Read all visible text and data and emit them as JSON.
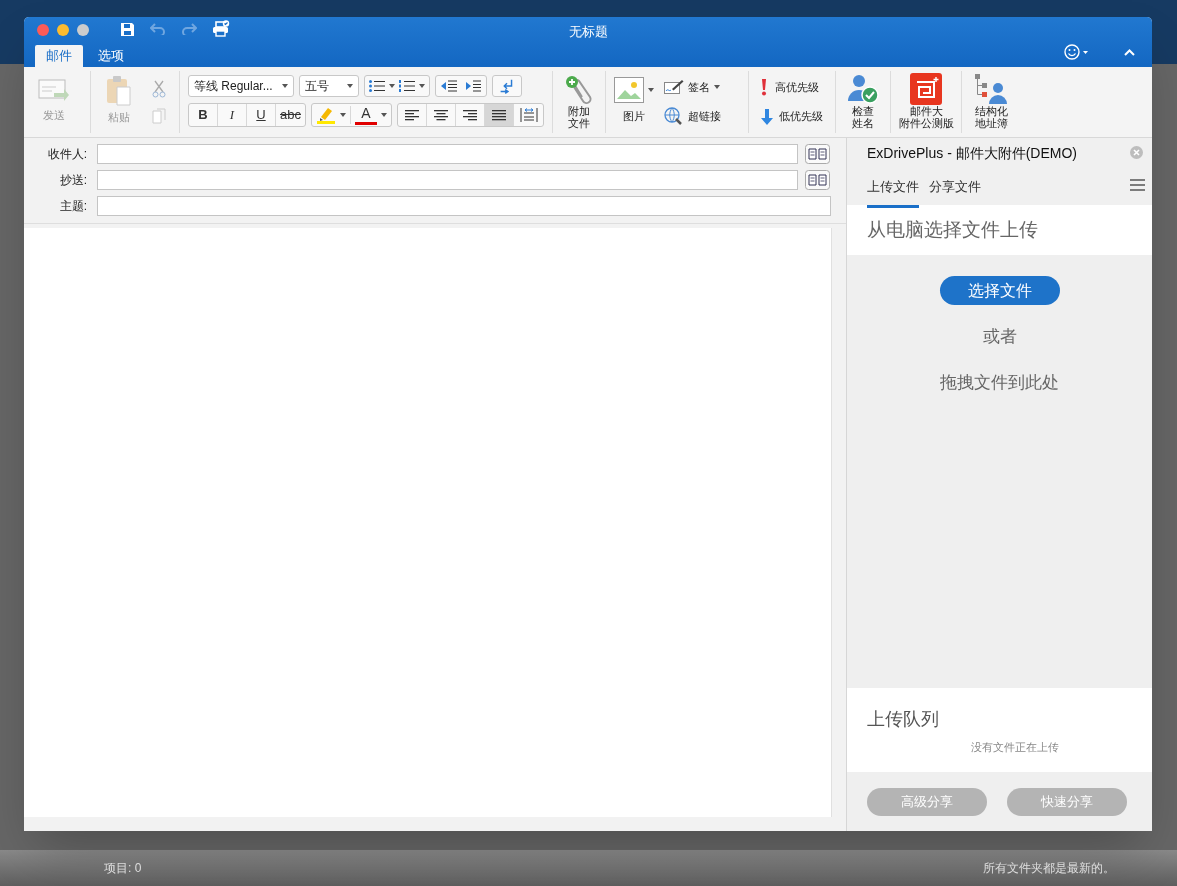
{
  "window": {
    "title": "无标题"
  },
  "ribbon_tabs": [
    {
      "label": "邮件",
      "selected": true
    },
    {
      "label": "选项",
      "selected": false
    }
  ],
  "ribbon": {
    "send": "发送",
    "paste": "粘贴",
    "font": "等线 Regular...",
    "size": "五号",
    "format_buttons": [
      "B",
      "I",
      "U",
      "abc"
    ],
    "font_color": "A",
    "alignment": [
      {
        "selected": false
      },
      {
        "selected": false
      },
      {
        "selected": false
      },
      {
        "selected": true
      }
    ],
    "attach": [
      "附加",
      "文件"
    ],
    "picture": "图片",
    "signature": "签名",
    "hyperlink": "超链接",
    "high_priority": "高优先级",
    "low_priority": "低优先级",
    "check_names": [
      "检查",
      "姓名"
    ],
    "big_attachment": [
      "邮件大",
      "附件公测版"
    ],
    "address_book": [
      "结构化",
      "地址簿"
    ]
  },
  "fields": [
    {
      "label": "收件人:",
      "kind": "address"
    },
    {
      "label": "抄送:",
      "kind": "address"
    },
    {
      "label": "主题:",
      "kind": "plain"
    }
  ],
  "pane": {
    "title": "ExDrivePlus - 邮件大附件(DEMO)",
    "tabs": [
      {
        "label": "上传文件",
        "selected": true
      },
      {
        "label": "分享文件",
        "selected": false
      }
    ],
    "upload_heading": "从电脑选择文件上传",
    "choose_button": "选择文件",
    "or": "或者",
    "drop_hint": "拖拽文件到此处",
    "queue_title": "上传队列",
    "queue_empty": "没有文件正在上传",
    "buttons": [
      {
        "label": "高级分享",
        "disabled": true
      },
      {
        "label": "快速分享",
        "disabled": true
      }
    ]
  },
  "status_bar": {
    "items": "项目: 0",
    "sync": "所有文件夹都是最新的。"
  }
}
